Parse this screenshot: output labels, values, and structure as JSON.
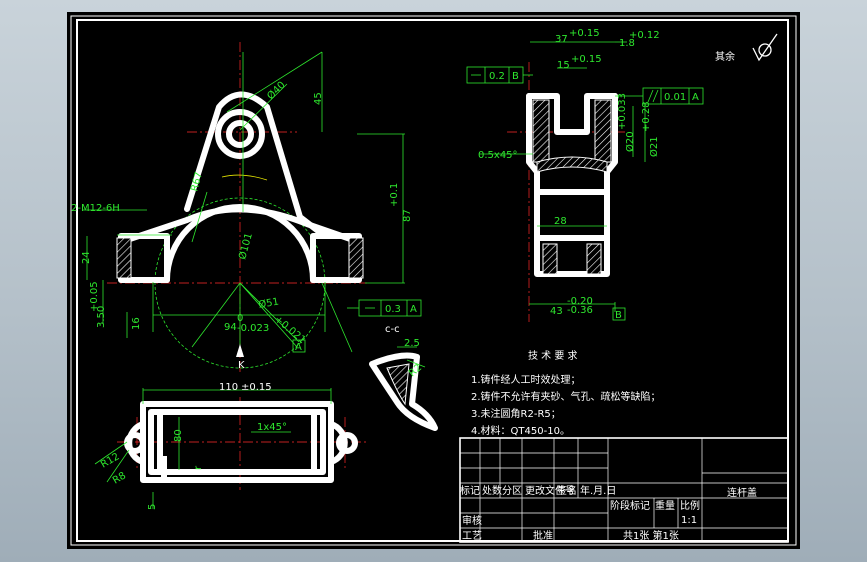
{
  "drawing": {
    "roughness_note": "其余",
    "section_label": "c-c",
    "view_label": "K",
    "dimensions": {
      "d40": "Ø40",
      "h45": "45",
      "r67": "R67",
      "d101": "Ø101",
      "d51": "Ø51",
      "d51_tol": "+0.021",
      "d94": "94",
      "d94_sup": "0",
      "d94_sub": "-0.023",
      "h87": "87",
      "h87_tol": "+0.1",
      "m12": "2-M12-6H",
      "h24": "24",
      "h3_5": "3.50",
      "h3_5_tol": "+0.05",
      "h16": "16",
      "w110": "110",
      "w110_tol": "±0.15",
      "chamfer_1": "1x45°",
      "r12": "R12",
      "r8": "R8",
      "h80": "80",
      "h5": "5",
      "r_small": "r",
      "d2_5": "2.5",
      "r2": "R2",
      "w37": "37",
      "w37_tol": "+0.15",
      "w15": "15",
      "w15_tol": "+0.15",
      "w1_8": "1.8",
      "w1_8_tol": "+0.12",
      "chamfer_0_5": "0.5x45°",
      "d20": "Ø20",
      "d20_tol": "+0.033",
      "d21": "Ø21",
      "d21_tol": "+0.28",
      "w28": "28",
      "w43": "43",
      "w43_sup": "-0.20",
      "w43_sub": "-0.36"
    },
    "tolerances": {
      "flat_top": "0.2",
      "flat_top_ref": "B",
      "parallel": "0.01",
      "parallel_ref": "A",
      "flat_bottom": "0.3",
      "flat_bottom_ref": "A",
      "datum_b": "B",
      "datum_a": "A"
    },
    "tech_req": {
      "title": "技 术 要 求",
      "items": [
        "1.铸件经人工时效处理；",
        "2.铸件不允许有夹砂、气孔、疏松等缺陷；",
        "3.未注圆角R2-R5；",
        "4.材料：QT450-10。"
      ]
    },
    "title_block": {
      "part_name": "连杆盖",
      "row_labels": [
        "标记",
        "处数",
        "分区",
        "更改文件号",
        "签名",
        "年.月.日"
      ],
      "mark_label": "阶段标记",
      "weight_label": "重量",
      "scale_label": "比例",
      "scale_value": "1:1",
      "review_label": "审核",
      "process_label": "工艺",
      "approve_label": "批准",
      "sheets": "共1张  第1张"
    }
  },
  "colors": {
    "background": "#000000",
    "outline": "#ffffff",
    "dimension": "#2ee82e",
    "center_line": "#ff2a2a",
    "frame": "#ffffff"
  }
}
